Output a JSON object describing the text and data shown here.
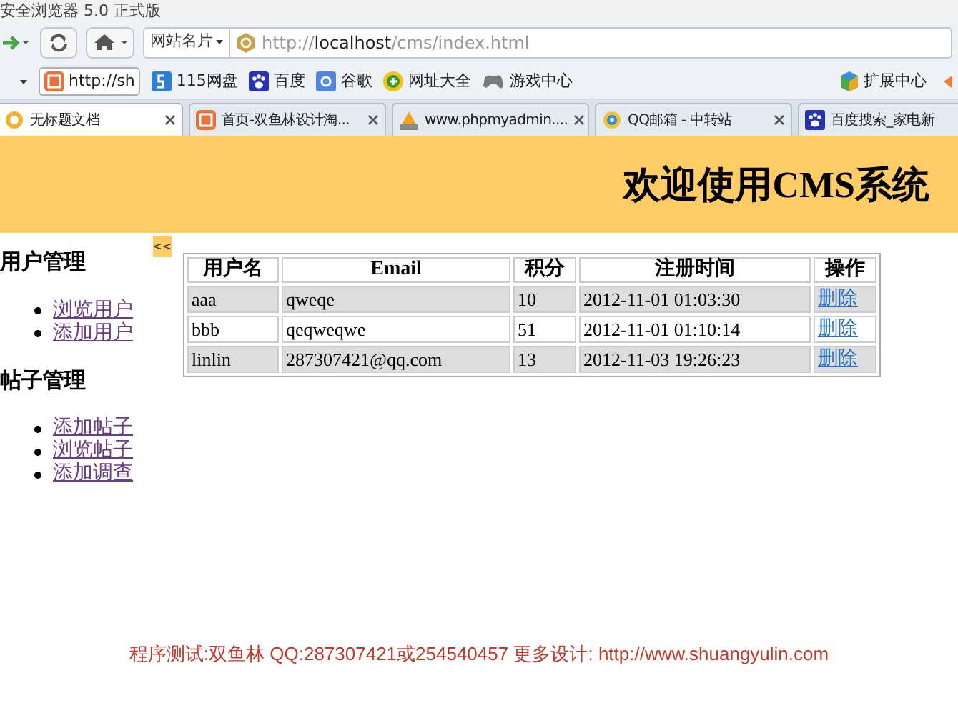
{
  "window": {
    "title": "安全浏览器 5.0 正式版"
  },
  "toolbar": {
    "site_button": "网站名片",
    "url_host": "localhost",
    "url_prefix": "http://",
    "url_path": "/cms/index.html"
  },
  "bookmarks": [
    {
      "label": "http://sh",
      "kind": "pill"
    },
    {
      "label": "115网盘",
      "kind": "b115"
    },
    {
      "label": "百度",
      "kind": "paw"
    },
    {
      "label": "谷歌",
      "kind": "g"
    },
    {
      "label": "网址大全",
      "kind": "plus"
    },
    {
      "label": "游戏中心",
      "kind": "pad"
    }
  ],
  "extension_center": "扩展中心",
  "tabs": [
    {
      "label": "无标题文档",
      "selected": true,
      "kind": "page"
    },
    {
      "label": "首页-双鱼林设计淘...",
      "selected": false,
      "kind": "taobao"
    },
    {
      "label": "www.phpmyadmin....",
      "selected": false,
      "kind": "pma"
    },
    {
      "label": "QQ邮箱 - 中转站",
      "selected": false,
      "kind": "qq"
    },
    {
      "label": "百度搜索_家电新",
      "selected": false,
      "kind": "paw"
    }
  ],
  "page": {
    "header": "欢迎使用CMS系统",
    "collapse_button": "<<",
    "sidebar": [
      {
        "title": "用户管理",
        "links": [
          "浏览用户",
          "添加用户"
        ]
      },
      {
        "title": "帖子管理",
        "links": [
          "添加帖子",
          "浏览帖子",
          "添加调查"
        ]
      }
    ],
    "table": {
      "columns": [
        "用户名",
        "Email",
        "积分",
        "注册时间",
        "操作"
      ],
      "rows": [
        [
          "aaa",
          "qweqe",
          "10",
          "2012-11-01 01:03:30",
          "删除"
        ],
        [
          "bbb",
          "qeqweqwe",
          "51",
          "2012-11-01 01:10:14",
          "删除"
        ],
        [
          "linlin",
          "287307421@qq.com",
          "13",
          "2012-11-03 19:26:23",
          "删除"
        ]
      ]
    },
    "footer": "程序测试:双鱼林 QQ:287307421或254540457 更多设计: http://www.shuangyulin.com"
  }
}
